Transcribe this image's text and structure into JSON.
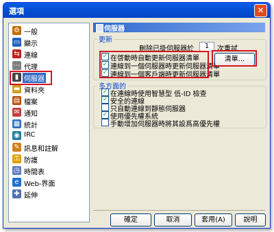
{
  "window": {
    "title": "選項",
    "close_glyph": "✕"
  },
  "sidebar": {
    "items": [
      {
        "label": "一般",
        "icon": "settings-icon",
        "color": "#c07000"
      },
      {
        "label": "顯示",
        "icon": "display-icon",
        "color": "#2060c0"
      },
      {
        "label": "連線",
        "icon": "connection-icon",
        "color": "#c02020"
      },
      {
        "label": "代理",
        "icon": "proxy-icon",
        "color": "#808080"
      },
      {
        "label": "伺服器",
        "icon": "server-icon",
        "color": "#404040",
        "selected": true
      },
      {
        "label": "資料夾",
        "icon": "folder-icon",
        "color": "#d0a020"
      },
      {
        "label": "檔案",
        "icon": "file-icon",
        "color": "#b05010"
      },
      {
        "label": "通知",
        "icon": "notification-icon",
        "color": "#c04040"
      },
      {
        "label": "統計",
        "icon": "statistics-icon",
        "color": "#3070c0"
      },
      {
        "label": "IRC",
        "icon": "irc-icon",
        "color": "#2080a0"
      },
      {
        "label": "訊息和註解",
        "icon": "message-icon",
        "color": "#d08020"
      },
      {
        "label": "防護",
        "icon": "security-icon",
        "color": "#e0a000"
      },
      {
        "label": "時間表",
        "icon": "schedule-icon",
        "color": "#6080c0"
      },
      {
        "label": "Web-界面",
        "icon": "web-icon",
        "color": "#2070d0"
      },
      {
        "label": "延伸",
        "icon": "extension-icon",
        "color": "#5070b0"
      }
    ]
  },
  "panel": {
    "title": "伺服器",
    "update_group": {
      "legend": "更新",
      "remove_dead_prefix": "刪除已掛伺服器於",
      "remove_dead_value": "1",
      "remove_dead_suffix": "次重試",
      "list_button": "清單...",
      "checks": [
        {
          "label": "在啓動時自動更新伺服器清單",
          "checked": true
        },
        {
          "label": "連線到一個伺服器時更新伺服器清單",
          "checked": true
        },
        {
          "label": "連線到一個客戶端時更新伺服器清單",
          "checked": true
        }
      ]
    },
    "misc_group": {
      "legend": "多方面的",
      "checks": [
        {
          "label": "在連線時使用智慧型 低-ID 檢查",
          "checked": true
        },
        {
          "label": "安全的連線",
          "checked": true
        },
        {
          "label": "只自動連線到靜態伺服器",
          "checked": false
        },
        {
          "label": "使用優先權系統",
          "checked": true
        },
        {
          "label": "手動增加伺服器時將其設爲高優先權",
          "checked": false
        }
      ]
    }
  },
  "buttons": {
    "ok": "確定",
    "cancel": "取消",
    "apply": "套用(A)",
    "help": "說明"
  }
}
